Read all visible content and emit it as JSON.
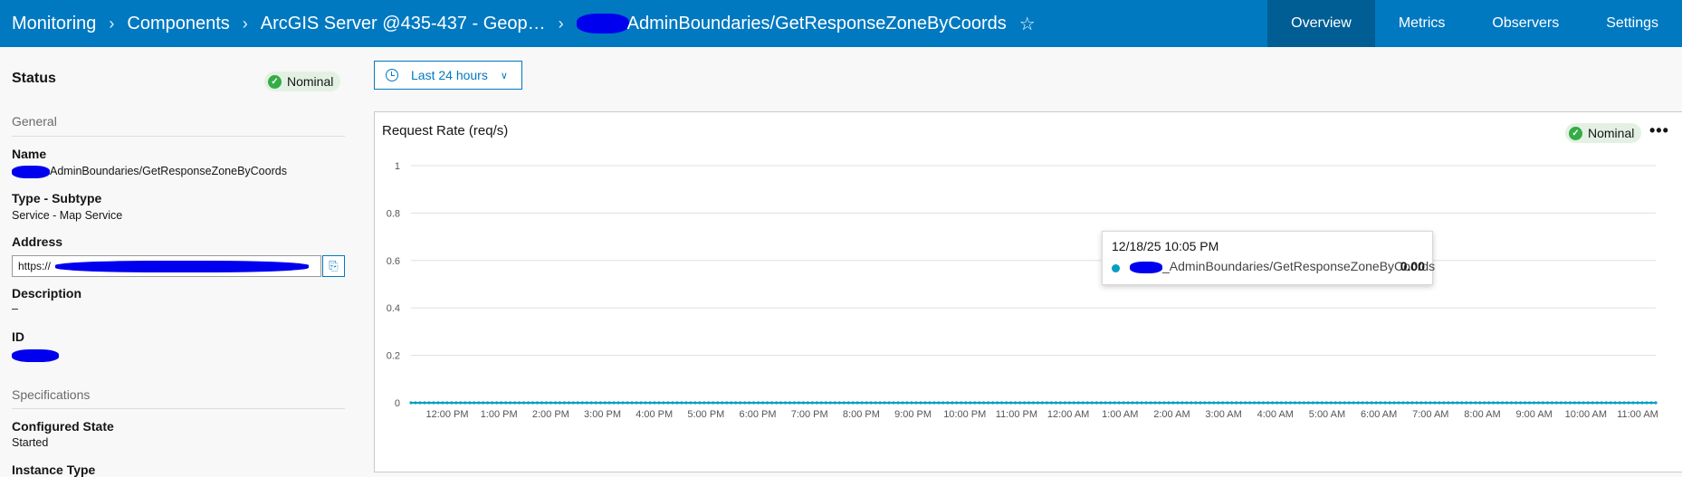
{
  "header": {
    "breadcrumb": [
      "Monitoring",
      "Components",
      "ArcGIS Server @435-437 - Geop…"
    ],
    "current_name": "AdminBoundaries/GetResponseZoneByCoords",
    "favorite_icon": "star-icon",
    "tabs": [
      {
        "label": "Overview",
        "active": true
      },
      {
        "label": "Metrics",
        "active": false
      },
      {
        "label": "Observers",
        "active": false
      },
      {
        "label": "Settings",
        "active": false
      }
    ]
  },
  "sidebar": {
    "status_title": "Status",
    "status_badge": "Nominal",
    "general_title": "General",
    "name_label": "Name",
    "name_value": "AdminBoundaries/GetResponseZoneByCoords",
    "type_label": "Type - Subtype",
    "type_value": "Service - Map Service",
    "address_label": "Address",
    "address_value": "https://",
    "description_label": "Description",
    "description_value": "–",
    "id_label": "ID",
    "specs_title": "Specifications",
    "configured_label": "Configured State",
    "configured_value": "Started",
    "instance_label": "Instance Type"
  },
  "time_filter": {
    "label": "Last 24 hours"
  },
  "chart_card": {
    "status_badge": "Nominal",
    "tooltip": {
      "time": "12/18/25 10:05 PM",
      "series": "_AdminBoundaries/GetResponseZoneByCoords",
      "value": "0.00"
    }
  },
  "colors": {
    "header": "#0079c1",
    "series": "#009fc2",
    "nominal": "#35ac46"
  },
  "chart_data": {
    "type": "line",
    "title": "Request Rate (req/s)",
    "ylim": [
      0,
      1
    ],
    "yticks": [
      "0",
      "0.2",
      "0.4",
      "0.6",
      "0.8",
      "1"
    ],
    "categories": [
      "12:00 PM",
      "1:00 PM",
      "2:00 PM",
      "3:00 PM",
      "4:00 PM",
      "5:00 PM",
      "6:00 PM",
      "7:00 PM",
      "8:00 PM",
      "9:00 PM",
      "10:00 PM",
      "11:00 PM",
      "12:00 AM",
      "1:00 AM",
      "2:00 AM",
      "3:00 AM",
      "4:00 AM",
      "5:00 AM",
      "6:00 AM",
      "7:00 AM",
      "8:00 AM",
      "9:00 AM",
      "10:00 AM",
      "11:00 AM"
    ],
    "series": [
      {
        "name": "_AdminBoundaries/GetResponseZoneByCoords",
        "values": [
          0,
          0,
          0,
          0,
          0,
          0,
          0,
          0,
          0,
          0,
          0,
          0,
          0,
          0,
          0,
          0,
          0,
          0,
          0,
          0,
          0,
          0,
          0,
          0
        ]
      }
    ],
    "grid": true,
    "legend": "none"
  }
}
